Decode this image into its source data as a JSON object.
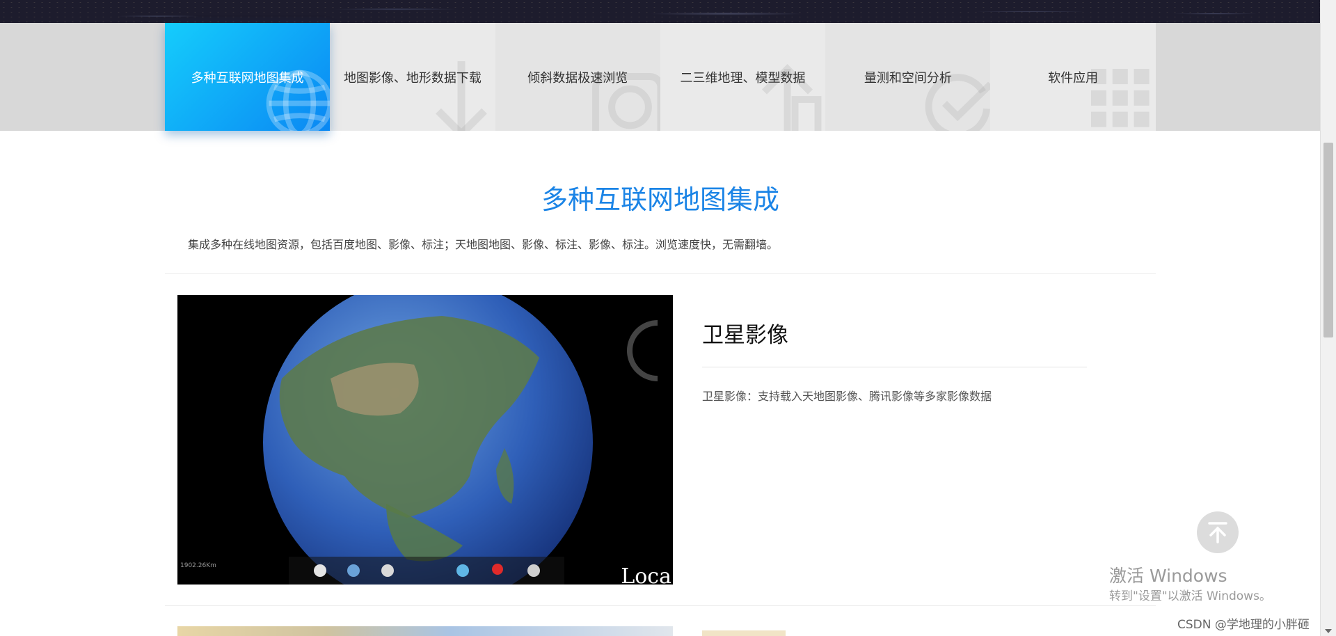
{
  "nav": {
    "tabs": [
      {
        "label": "多种互联网地图集成",
        "icon": "globe-icon",
        "active": true
      },
      {
        "label": "地图影像、地形数据下载",
        "icon": "download-arrow-icon",
        "active": false
      },
      {
        "label": "倾斜数据极速浏览",
        "icon": "camera-icon",
        "active": false
      },
      {
        "label": "二三维地理、模型数据",
        "icon": "up-arrow-icon",
        "active": false
      },
      {
        "label": "量测和空间分析",
        "icon": "check-circle-icon",
        "active": false
      },
      {
        "label": "软件应用",
        "icon": "grid-icon",
        "active": false
      }
    ]
  },
  "section": {
    "title": "多种互联网地图集成",
    "description": "集成多种在线地图资源，包括百度地图、影像、标注；天地图地图、影像、标注、影像、标注。浏览速度快，无需翻墙。"
  },
  "feature": {
    "title": "卫星影像",
    "description": "卫星影像：支持载入天地图影像、腾讯影像等多家影像数据",
    "image_overlay_text": "Loca",
    "image_scale_text": "1902.26Km"
  },
  "overlay": {
    "back_to_top_icon": "arrow-up-icon",
    "activation_line1": "激活 Windows",
    "activation_line2": "转到\"设置\"以激活 Windows。",
    "csdn_watermark": "CSDN @学地理的小胖砸"
  },
  "colors": {
    "accent": "#1b84e6",
    "active_tab_from": "#15cdfc",
    "active_tab_to": "#0a87f3"
  }
}
